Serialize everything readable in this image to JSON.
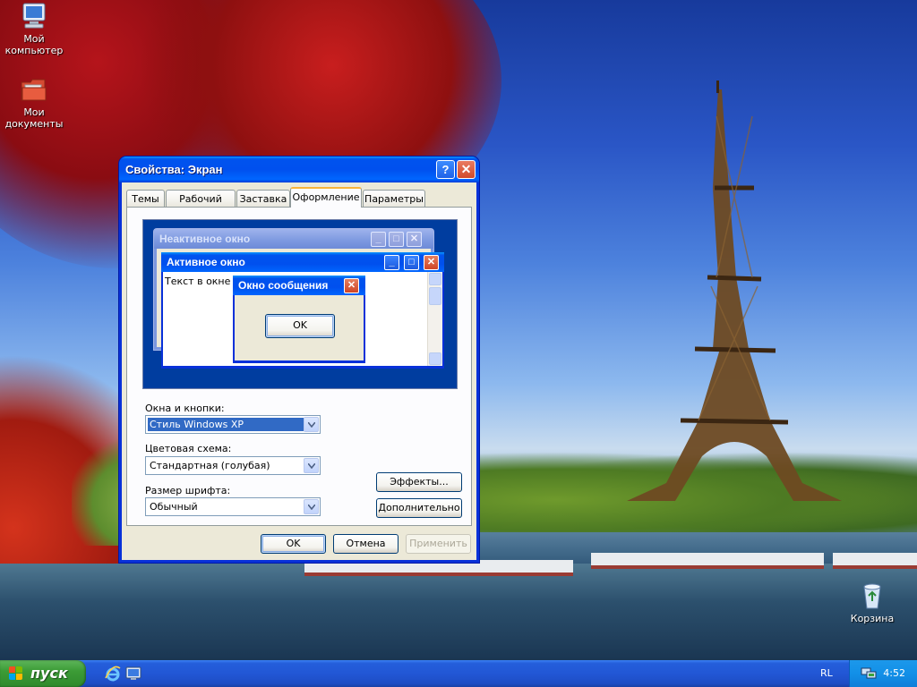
{
  "desktop": {
    "icons": [
      {
        "label": "Мой компьютер",
        "icon": "my-computer-icon"
      },
      {
        "label": "Мои документы",
        "icon": "my-documents-icon"
      },
      {
        "label": "Корзина",
        "icon": "recycle-bin-icon"
      }
    ]
  },
  "dialog": {
    "title": "Свойства: Экран",
    "help": "?",
    "close": "✕",
    "tabs": [
      "Темы",
      "Рабочий стол",
      "Заставка",
      "Оформление",
      "Параметры"
    ],
    "active_tab": "Оформление",
    "preview": {
      "inactive_title": "Неактивное окно",
      "active_title": "Активное окно",
      "window_text": "Текст в окне",
      "message_title": "Окно сообщения",
      "message_ok": "OK"
    },
    "windows_buttons_label": "Окна и кнопки:",
    "windows_buttons_value": "Стиль Windows XP",
    "color_scheme_label": "Цветовая схема:",
    "color_scheme_value": "Стандартная (голубая)",
    "font_size_label": "Размер шрифта:",
    "font_size_value": "Обычный",
    "effects_button": "Эффекты...",
    "advanced_button": "Дополнительно",
    "ok_button": "OK",
    "cancel_button": "Отмена",
    "apply_button": "Применить"
  },
  "taskbar": {
    "start_label": "пуск",
    "quick_launch": [
      "internet-explorer-icon",
      "show-desktop-icon"
    ],
    "language": "RL",
    "clock": "4:52",
    "tray_icon": "network-icon"
  },
  "colors": {
    "title_bar": "#0053ee",
    "dialog_face": "#ece9d8",
    "taskbar": "#245edb",
    "start_button": "#3c9c36",
    "tray": "#1290e8",
    "preview_desktop": "#003d9f",
    "selection": "#316ac5"
  }
}
